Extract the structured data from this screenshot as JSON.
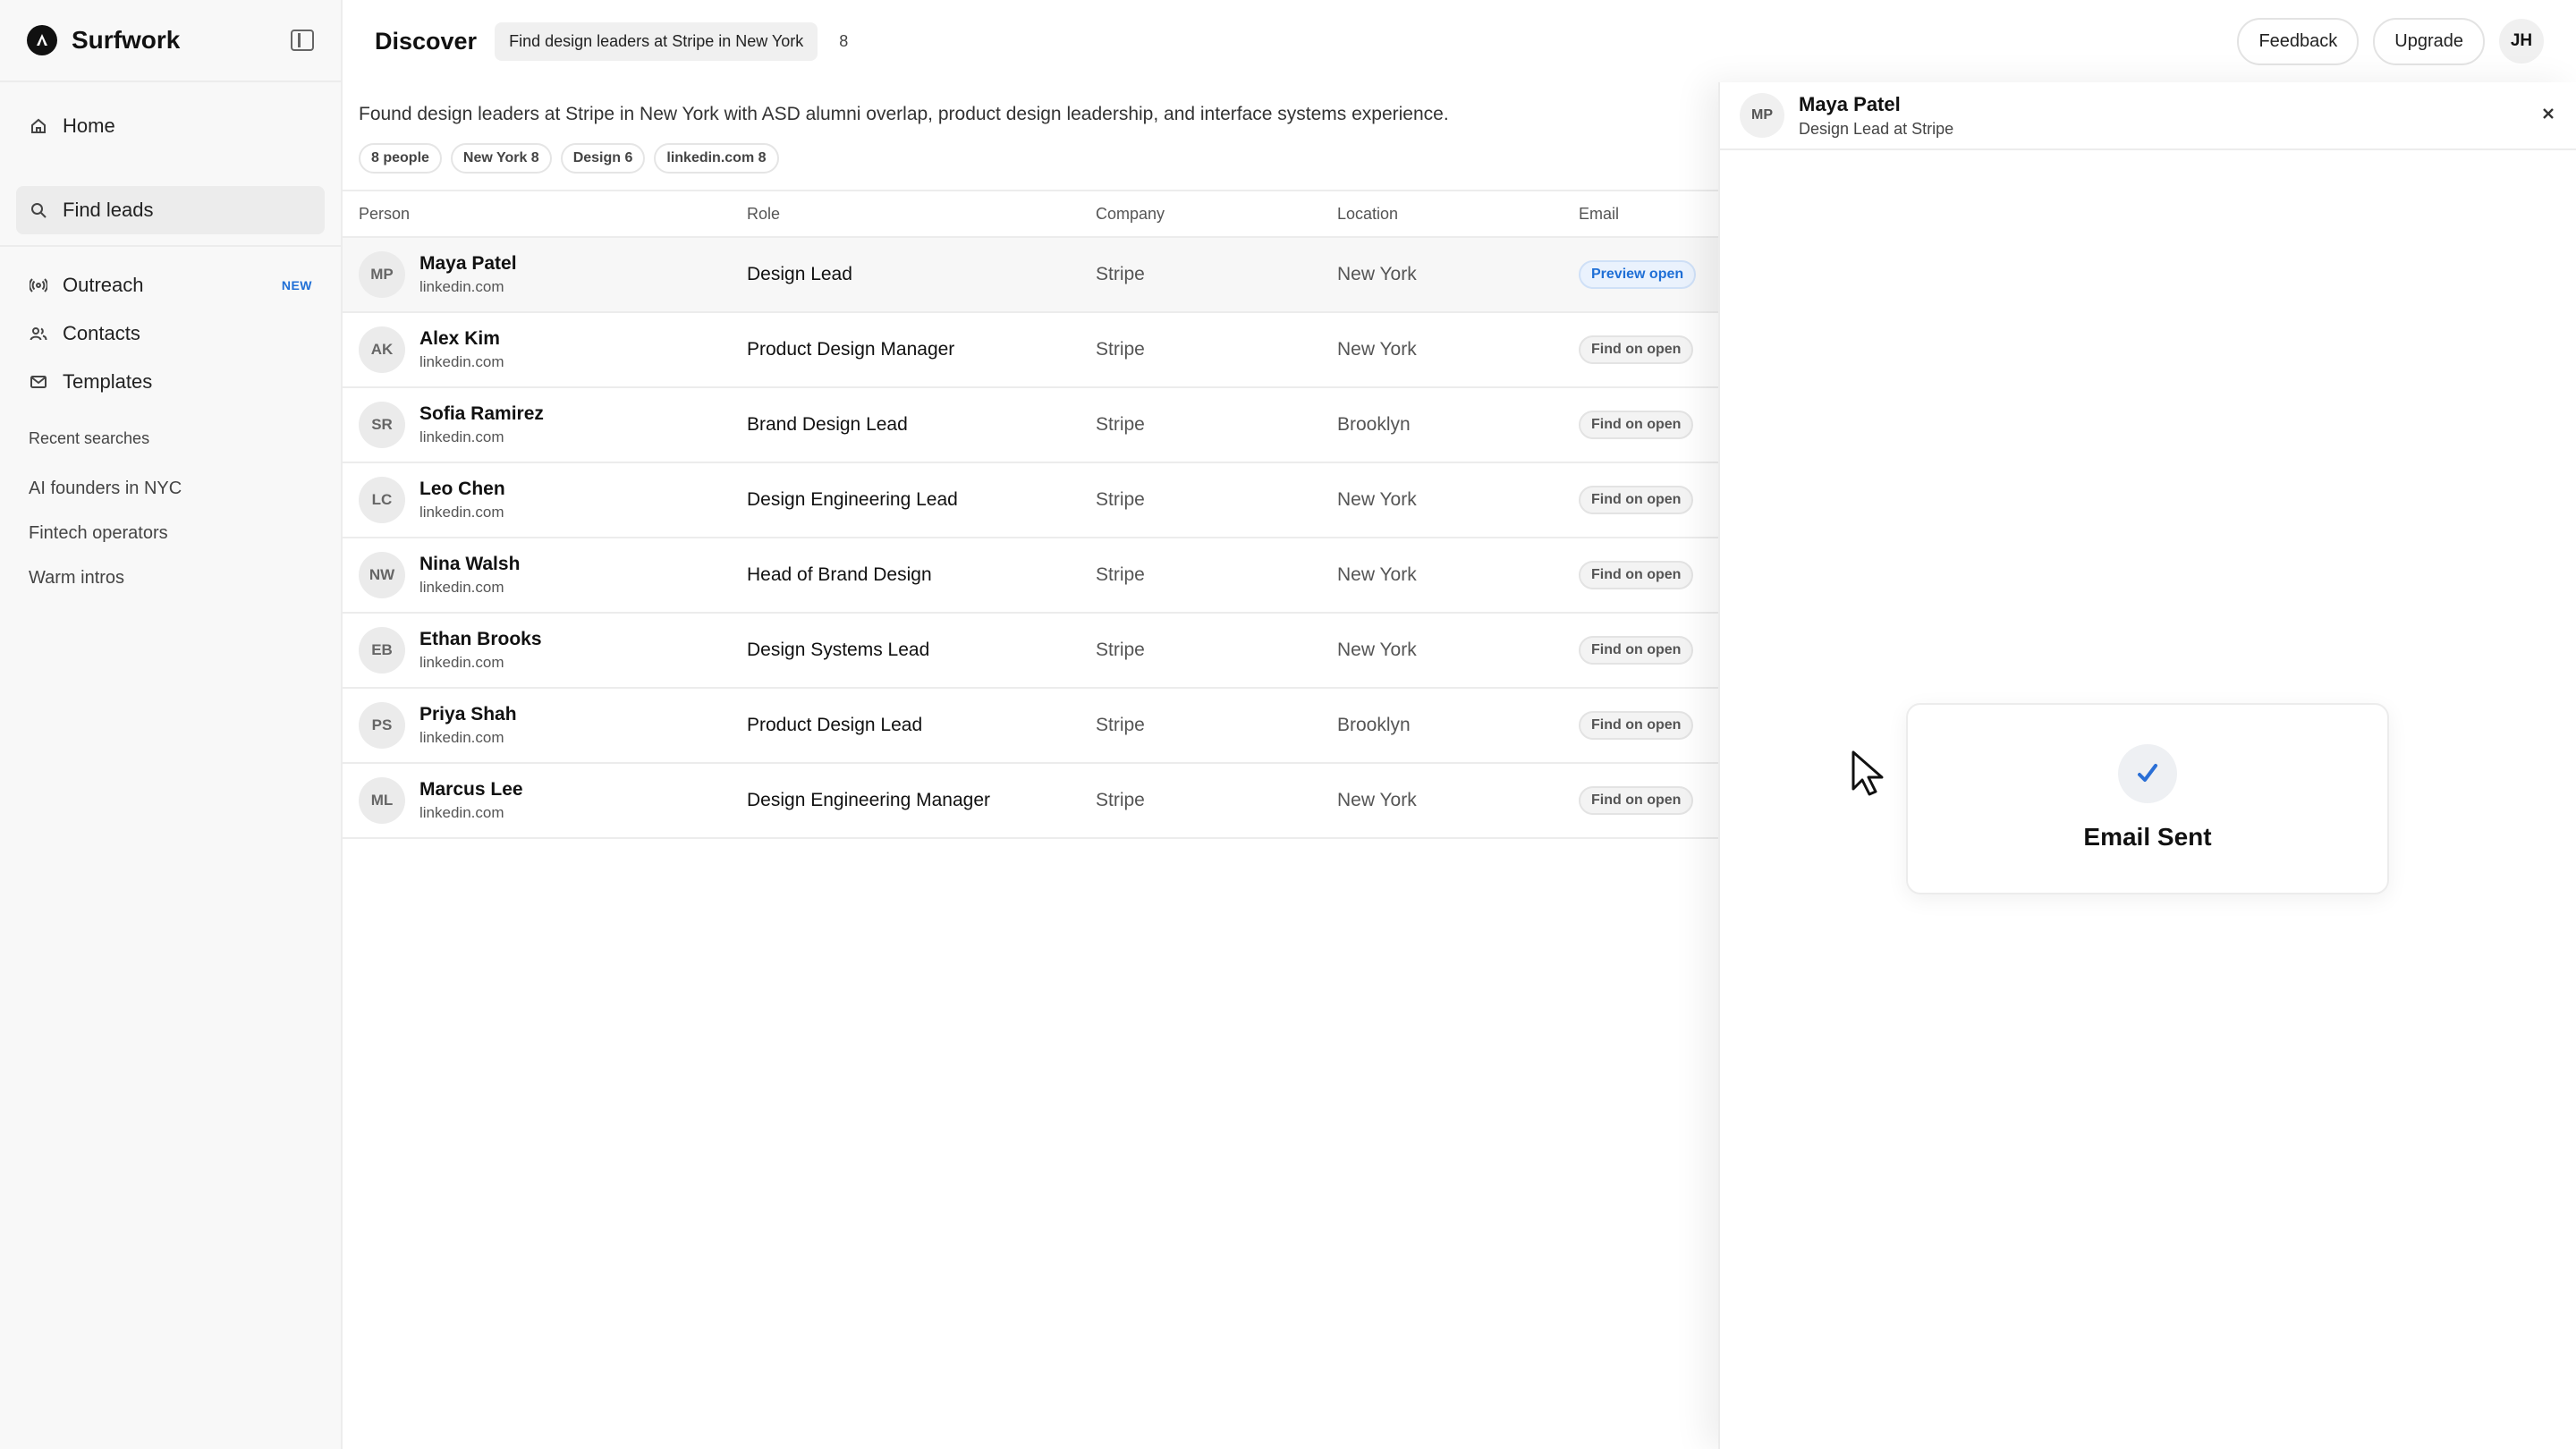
{
  "app": {
    "name": "Surfwork"
  },
  "sidebar": {
    "nav": [
      {
        "label": "Home",
        "icon": "home-icon"
      },
      {
        "label": "Find leads",
        "icon": "search-icon",
        "active": true
      }
    ],
    "nav2": [
      {
        "label": "Outreach",
        "icon": "broadcast-icon",
        "badge": "NEW"
      },
      {
        "label": "Contacts",
        "icon": "users-icon"
      },
      {
        "label": "Templates",
        "icon": "mail-icon"
      }
    ],
    "recent_heading": "Recent searches",
    "recent": [
      "AI founders in NYC",
      "Fintech operators",
      "Warm intros"
    ]
  },
  "header": {
    "title": "Discover",
    "query": "Find design leaders at Stripe in New York",
    "count": "8",
    "feedback": "Feedback",
    "upgrade": "Upgrade",
    "user_initials": "JH"
  },
  "results": {
    "summary": "Found design leaders at Stripe in New York with ASD alumni overlap, product design leadership, and interface systems experience.",
    "chips": [
      "8 people",
      "New York 8",
      "Design 6",
      "linkedin.com 8"
    ],
    "columns": {
      "person": "Person",
      "role": "Role",
      "company": "Company",
      "location": "Location",
      "email": "Email"
    },
    "rows": [
      {
        "initials": "MP",
        "name": "Maya Patel",
        "source": "linkedin.com",
        "role": "Design Lead",
        "company": "Stripe",
        "location": "New York",
        "email": "Preview open",
        "selected": true
      },
      {
        "initials": "AK",
        "name": "Alex Kim",
        "source": "linkedin.com",
        "role": "Product Design Manager",
        "company": "Stripe",
        "location": "New York",
        "email": "Find on open"
      },
      {
        "initials": "SR",
        "name": "Sofia Ramirez",
        "source": "linkedin.com",
        "role": "Brand Design Lead",
        "company": "Stripe",
        "location": "Brooklyn",
        "email": "Find on open"
      },
      {
        "initials": "LC",
        "name": "Leo Chen",
        "source": "linkedin.com",
        "role": "Design Engineering Lead",
        "company": "Stripe",
        "location": "New York",
        "email": "Find on open"
      },
      {
        "initials": "NW",
        "name": "Nina Walsh",
        "source": "linkedin.com",
        "role": "Head of Brand Design",
        "company": "Stripe",
        "location": "New York",
        "email": "Find on open"
      },
      {
        "initials": "EB",
        "name": "Ethan Brooks",
        "source": "linkedin.com",
        "role": "Design Systems Lead",
        "company": "Stripe",
        "location": "New York",
        "email": "Find on open"
      },
      {
        "initials": "PS",
        "name": "Priya Shah",
        "source": "linkedin.com",
        "role": "Product Design Lead",
        "company": "Stripe",
        "location": "Brooklyn",
        "email": "Find on open"
      },
      {
        "initials": "ML",
        "name": "Marcus Lee",
        "source": "linkedin.com",
        "role": "Design Engineering Manager",
        "company": "Stripe",
        "location": "New York",
        "email": "Find on open"
      }
    ]
  },
  "panel": {
    "initials": "MP",
    "name": "Maya Patel",
    "subtitle": "Design Lead at Stripe",
    "close_icon": "close-icon"
  },
  "toast": {
    "text": "Email Sent",
    "icon": "check-icon"
  },
  "colors": {
    "accent": "#1f6fd6",
    "check": "#2a6fd6"
  }
}
